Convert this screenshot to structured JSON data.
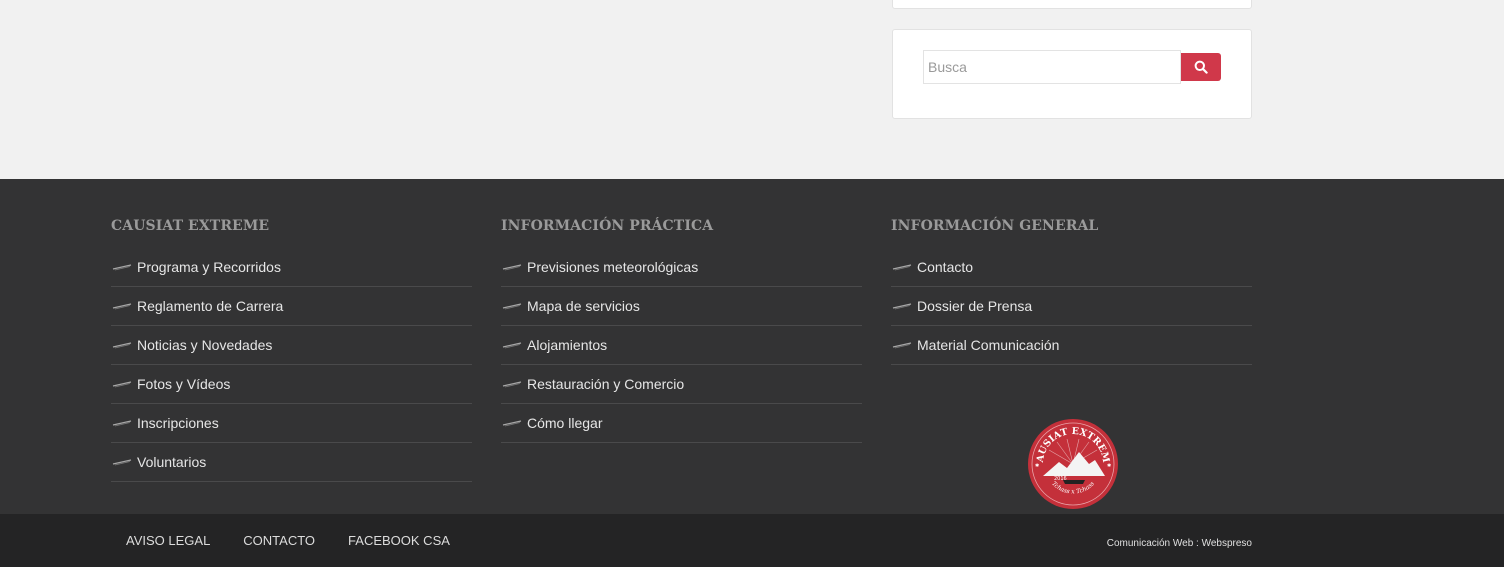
{
  "search": {
    "placeholder": "Busca",
    "button_icon": "search-icon"
  },
  "footer": {
    "columns": [
      {
        "title": "CAUSIAT EXTREME",
        "links": [
          "Programa y Recorridos",
          "Reglamento de Carrera",
          "Noticias y Novedades",
          "Fotos y Vídeos",
          "Inscripciones",
          "Voluntarios"
        ]
      },
      {
        "title": "INFORMACIÓN PRÁCTICA",
        "links": [
          "Previsiones meteorológicas",
          "Mapa de servicios",
          "Alojamientos",
          "Restauración y Comercio",
          "Cómo llegar"
        ]
      },
      {
        "title": "INFORMACIÓN GENERAL",
        "links": [
          "Contacto",
          "Dossier de Prensa",
          "Material Comunicación"
        ]
      }
    ],
    "logo": {
      "text_top": "CAUSIAT EXTREME",
      "year": "2016",
      "text_bottom": "Tchass x Tchass"
    }
  },
  "bottom_bar": {
    "nav": [
      "AVISO LEGAL",
      "CONTACTO",
      "FACEBOOK CSA"
    ],
    "credit": "Comunicación Web : Webspreso"
  },
  "colors": {
    "accent": "#d0384a",
    "footer_bg": "#333334",
    "bottom_bg": "#242425",
    "page_bg": "#f1f1f1"
  }
}
